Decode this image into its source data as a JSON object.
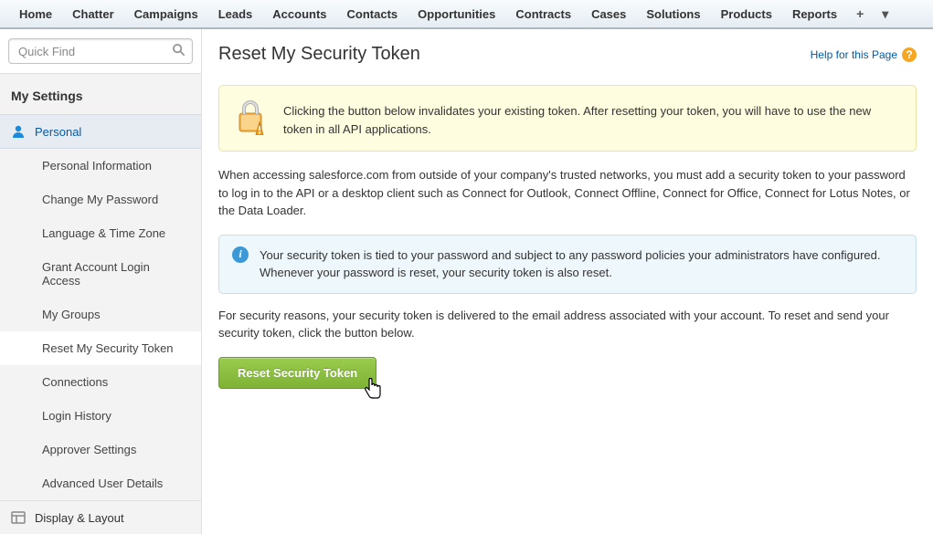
{
  "topnav": {
    "tabs": [
      "Home",
      "Chatter",
      "Campaigns",
      "Leads",
      "Accounts",
      "Contacts",
      "Opportunities",
      "Contracts",
      "Cases",
      "Solutions",
      "Products",
      "Reports"
    ]
  },
  "sidebar": {
    "search_placeholder": "Quick Find",
    "heading": "My Settings",
    "categories": [
      {
        "label": "Personal",
        "active": true
      },
      {
        "label": "Display & Layout",
        "active": false
      }
    ],
    "personal_items": [
      "Personal Information",
      "Change My Password",
      "Language & Time Zone",
      "Grant Account Login Access",
      "My Groups",
      "Reset My Security Token",
      "Connections",
      "Login History",
      "Approver Settings",
      "Advanced User Details"
    ],
    "selected_item_index": 5
  },
  "page": {
    "title": "Reset My Security Token",
    "help_label": "Help for this Page",
    "warning": "Clicking the button below invalidates your existing token. After resetting your token, you will have to use the new token in all API applications.",
    "para1": "When accessing salesforce.com from outside of your company's trusted networks, you must add a security token to your password to log in to the API or a desktop client such as Connect for Outlook, Connect Offline, Connect for Office, Connect for Lotus Notes, or the Data Loader.",
    "info": "Your security token is tied to your password and subject to any password policies your administrators have configured. Whenever your password is reset, your security token is also reset.",
    "para2": "For security reasons, your security token is delivered to the email address associated with your account. To reset and send your security token, click the button below.",
    "button_label": "Reset Security Token"
  }
}
